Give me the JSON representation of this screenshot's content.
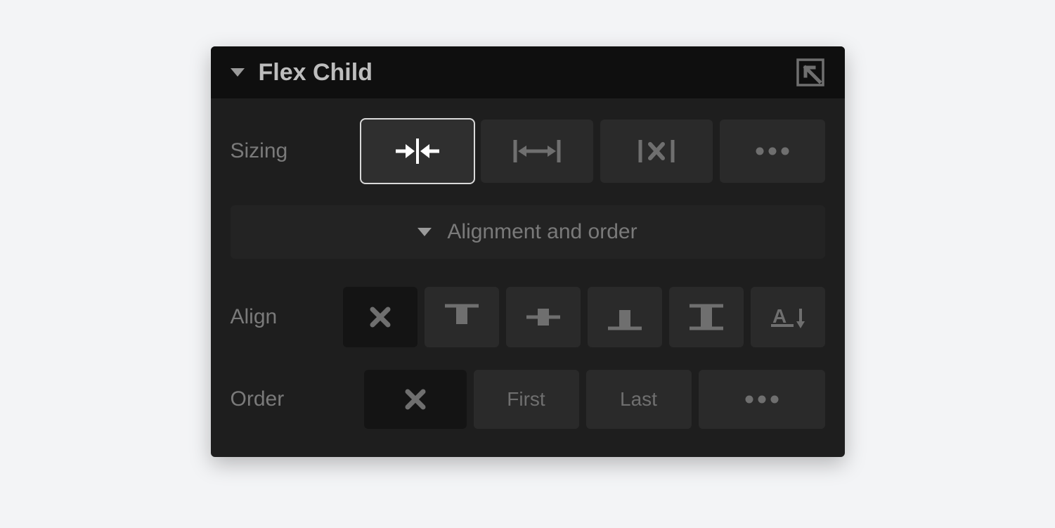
{
  "panel": {
    "title": "Flex Child",
    "titlebar_icon": "select-parent-icon"
  },
  "sizing": {
    "label": "Sizing",
    "options": [
      {
        "name": "shrink",
        "icon": "arrows-in-icon",
        "selected": true
      },
      {
        "name": "grow",
        "icon": "arrows-out-icon",
        "selected": false
      },
      {
        "name": "none",
        "icon": "no-flex-icon",
        "selected": false
      },
      {
        "name": "more",
        "icon": "more-icon",
        "selected": false
      }
    ]
  },
  "subsection": {
    "label": "Alignment and order"
  },
  "align": {
    "label": "Align",
    "options": [
      {
        "name": "auto",
        "icon": "close-x-icon",
        "selected": true
      },
      {
        "name": "start",
        "icon": "align-top-icon",
        "selected": false
      },
      {
        "name": "center",
        "icon": "align-center-icon",
        "selected": false
      },
      {
        "name": "end",
        "icon": "align-bottom-icon",
        "selected": false
      },
      {
        "name": "stretch",
        "icon": "align-stretch-icon",
        "selected": false
      },
      {
        "name": "baseline",
        "icon": "align-baseline-icon",
        "selected": false
      }
    ]
  },
  "order": {
    "label": "Order",
    "options": [
      {
        "name": "auto",
        "selected": true,
        "icon": "close-x-icon"
      },
      {
        "name": "first",
        "selected": false,
        "label": "First"
      },
      {
        "name": "last",
        "selected": false,
        "label": "Last"
      },
      {
        "name": "more",
        "selected": false,
        "icon": "more-icon"
      }
    ]
  }
}
